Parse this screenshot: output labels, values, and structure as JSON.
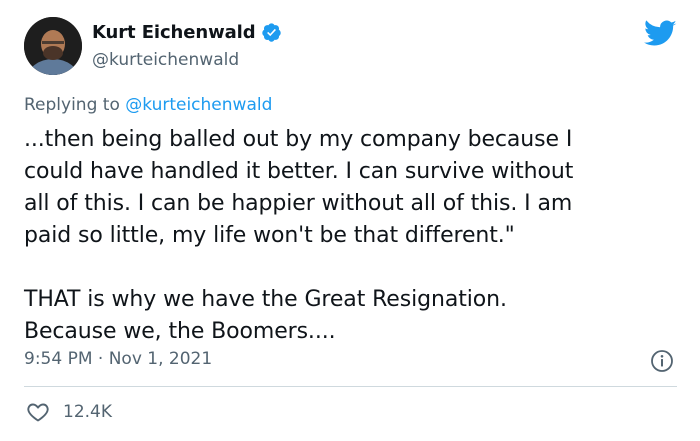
{
  "author": {
    "display_name": "Kurt Eichenwald",
    "handle": "@kurteichenwald",
    "verified_icon": "verified-badge-icon",
    "avatar_icon": "avatar"
  },
  "platform_icon": "twitter-bird-icon",
  "reply": {
    "prefix": "Replying to ",
    "mention": "@kurteichenwald"
  },
  "tweet": {
    "text": "...then being balled out by my company because I\ncould have handled it better. I can survive without\nall of this. I can be happier without all of this. I am\npaid so little, my life won't be that different.\"\n\nTHAT is why we have the Great Resignation.\nBecause we, the Boomers...."
  },
  "meta": {
    "timestamp": "9:54 PM · Nov 1, 2021"
  },
  "actions": {
    "like_count": "12.4K"
  },
  "colors": {
    "accent": "#1d9bf0",
    "secondary_text": "#536471",
    "divider": "#cfd9de"
  }
}
